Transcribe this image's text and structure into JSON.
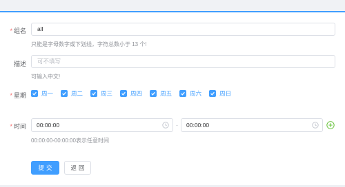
{
  "form": {
    "name": {
      "label": "组名",
      "value": "all",
      "hint": "只能是字母数字或下划线，字符总数小于 13 个!"
    },
    "description": {
      "label": "描述",
      "placeholder": "可不填写",
      "hint": "可输入中文!"
    },
    "weekdays": {
      "label": "星期",
      "options": [
        {
          "label": "周一",
          "checked": true
        },
        {
          "label": "周二",
          "checked": true
        },
        {
          "label": "周三",
          "checked": true
        },
        {
          "label": "周四",
          "checked": true
        },
        {
          "label": "周五",
          "checked": true
        },
        {
          "label": "周六",
          "checked": true
        },
        {
          "label": "周日",
          "checked": true
        }
      ]
    },
    "time": {
      "label": "时间",
      "start": "00:00:00",
      "end": "00:00:00",
      "separator": "-",
      "hint": "00:00:00-00:00:00表示任意时间"
    },
    "required_mark": "*",
    "submit_label": "提交",
    "back_label": "返回"
  },
  "colors": {
    "accent": "#409eff",
    "required": "#f56c6c",
    "add_icon": "#67c23a"
  }
}
